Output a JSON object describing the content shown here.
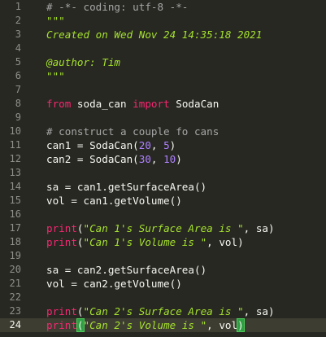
{
  "editor": {
    "current_line": 24,
    "lines": [
      {
        "n": "1",
        "tokens": [
          {
            "t": "comment",
            "v": "# -*- coding: utf-8 -*-"
          }
        ]
      },
      {
        "n": "2",
        "tokens": [
          {
            "t": "doc",
            "v": "\"\"\""
          }
        ]
      },
      {
        "n": "3",
        "tokens": [
          {
            "t": "doc",
            "v": "Created on Wed Nov 24 14:35:18 2021"
          }
        ]
      },
      {
        "n": "4",
        "tokens": []
      },
      {
        "n": "5",
        "tokens": [
          {
            "t": "doc",
            "v": "@author: Tim"
          }
        ]
      },
      {
        "n": "6",
        "tokens": [
          {
            "t": "doc",
            "v": "\"\"\""
          }
        ]
      },
      {
        "n": "7",
        "tokens": []
      },
      {
        "n": "8",
        "tokens": [
          {
            "t": "kw",
            "v": "from"
          },
          {
            "t": "plain",
            "v": " soda_can "
          },
          {
            "t": "kw",
            "v": "import"
          },
          {
            "t": "plain",
            "v": " SodaCan"
          }
        ]
      },
      {
        "n": "9",
        "tokens": []
      },
      {
        "n": "10",
        "tokens": [
          {
            "t": "comment",
            "v": "# construct a couple fo cans"
          }
        ]
      },
      {
        "n": "11",
        "tokens": [
          {
            "t": "plain",
            "v": "can1 = SodaCan("
          },
          {
            "t": "num",
            "v": "20"
          },
          {
            "t": "plain",
            "v": ", "
          },
          {
            "t": "num",
            "v": "5"
          },
          {
            "t": "plain",
            "v": ")"
          }
        ]
      },
      {
        "n": "12",
        "tokens": [
          {
            "t": "plain",
            "v": "can2 = SodaCan("
          },
          {
            "t": "num",
            "v": "30"
          },
          {
            "t": "plain",
            "v": ", "
          },
          {
            "t": "num",
            "v": "10"
          },
          {
            "t": "plain",
            "v": ")"
          }
        ]
      },
      {
        "n": "13",
        "tokens": []
      },
      {
        "n": "14",
        "tokens": [
          {
            "t": "plain",
            "v": "sa = can1.getSurfaceArea()"
          }
        ]
      },
      {
        "n": "15",
        "tokens": [
          {
            "t": "plain",
            "v": "vol = can1.getVolume()"
          }
        ]
      },
      {
        "n": "16",
        "tokens": []
      },
      {
        "n": "17",
        "tokens": [
          {
            "t": "fn",
            "v": "print"
          },
          {
            "t": "plain",
            "v": "("
          },
          {
            "t": "str",
            "v": "\"Can 1's Surface Area is \""
          },
          {
            "t": "plain",
            "v": ", sa)"
          }
        ]
      },
      {
        "n": "18",
        "tokens": [
          {
            "t": "fn",
            "v": "print"
          },
          {
            "t": "plain",
            "v": "("
          },
          {
            "t": "str",
            "v": "\"Can 1's Volume is \""
          },
          {
            "t": "plain",
            "v": ", vol)"
          }
        ]
      },
      {
        "n": "19",
        "tokens": []
      },
      {
        "n": "20",
        "tokens": [
          {
            "t": "plain",
            "v": "sa = can2.getSurfaceArea()"
          }
        ]
      },
      {
        "n": "21",
        "tokens": [
          {
            "t": "plain",
            "v": "vol = can2.getVolume()"
          }
        ]
      },
      {
        "n": "22",
        "tokens": []
      },
      {
        "n": "23",
        "tokens": [
          {
            "t": "fn",
            "v": "print"
          },
          {
            "t": "plain",
            "v": "("
          },
          {
            "t": "str",
            "v": "\"Can 2's Surface Area is \""
          },
          {
            "t": "plain",
            "v": ", sa)"
          }
        ]
      },
      {
        "n": "24",
        "tokens": [
          {
            "t": "fn",
            "v": "print"
          },
          {
            "t": "bracket",
            "v": "("
          },
          {
            "t": "str",
            "v": "\"Can 2's Volume is \""
          },
          {
            "t": "plain",
            "v": ", vol"
          },
          {
            "t": "bracket",
            "v": ")"
          },
          {
            "t": "caret",
            "v": ""
          }
        ]
      }
    ]
  },
  "colors": {
    "background": "#272822",
    "current_line": "#3e3d32",
    "keyword": "#f92672",
    "string": "#a6e22e",
    "number": "#ae81ff",
    "comment": "#a6a6a6",
    "bracket_match": "#2ea043"
  }
}
